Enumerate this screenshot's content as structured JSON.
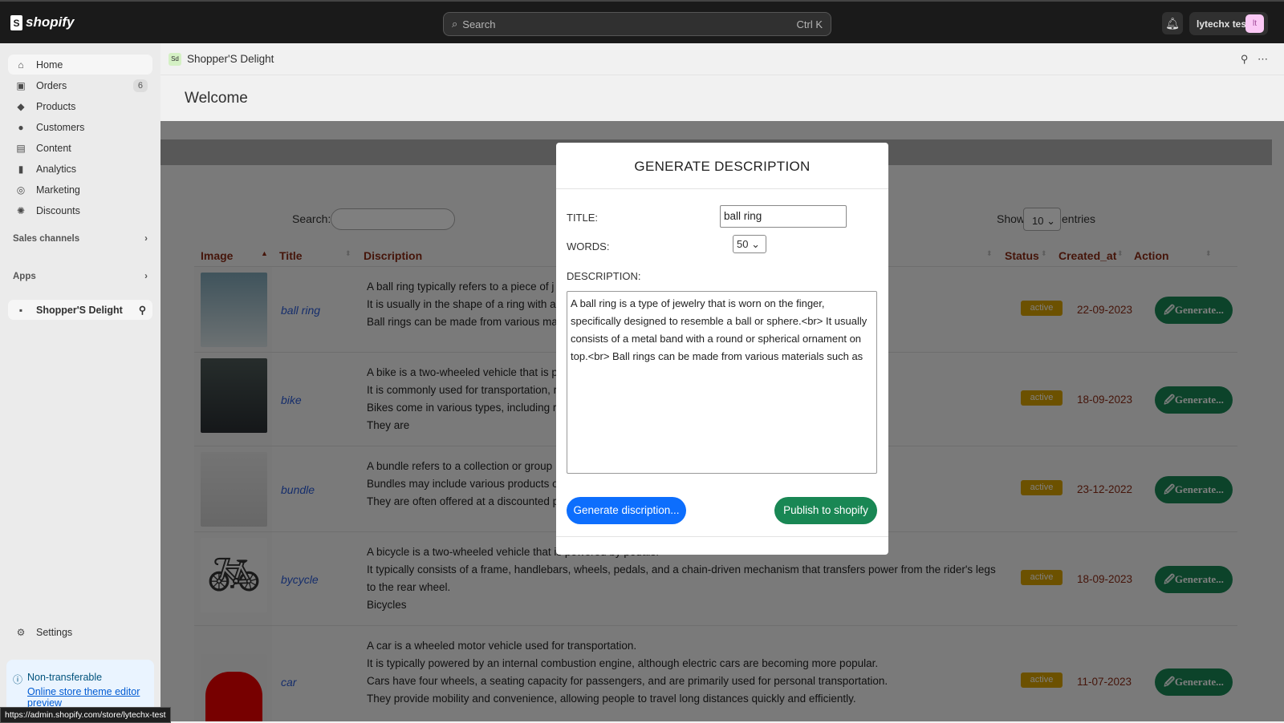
{
  "topbar": {
    "logo": "shopify",
    "search_placeholder": "Search",
    "shortcut": "Ctrl K",
    "user": "lytechx test",
    "avatar": "lt"
  },
  "sidebar": {
    "items": [
      {
        "label": "Home",
        "icon": "home-icon",
        "glyph": "⌂"
      },
      {
        "label": "Orders",
        "icon": "inbox-icon",
        "glyph": "▣",
        "badge": "6"
      },
      {
        "label": "Products",
        "icon": "tag-icon",
        "glyph": "◆"
      },
      {
        "label": "Customers",
        "icon": "person-icon",
        "glyph": "●"
      },
      {
        "label": "Content",
        "icon": "content-icon",
        "glyph": "▤"
      },
      {
        "label": "Analytics",
        "icon": "bar-chart-icon",
        "glyph": "▮"
      },
      {
        "label": "Marketing",
        "icon": "target-icon",
        "glyph": "◎"
      },
      {
        "label": "Discounts",
        "icon": "discount-icon",
        "glyph": "✺"
      }
    ],
    "sales_channels": "Sales channels",
    "apps": "Apps",
    "app_item": "Shopper'S Delight",
    "settings": "Settings",
    "notice": {
      "title": "Non-transferable",
      "link": "Online store theme editor preview"
    }
  },
  "status_url": "https://admin.shopify.com/store/lytechx-test",
  "app": {
    "name": "Shopper'S Delight",
    "welcome": "Welcome"
  },
  "table": {
    "search_label": "Search:",
    "show_label": "Show",
    "entries_value": "10",
    "entries_label": "entries",
    "headers": [
      "Image",
      "Title",
      "Discription",
      "Status",
      "Created_at",
      "Action"
    ],
    "rows": [
      {
        "title": "ball ring",
        "desc": [
          "A ball ring typically refers to a piece of j",
          "It is usually in the shape of a ring with a",
          "Ball rings can be made from various mat"
        ],
        "status": "active",
        "created": "22-09-2023",
        "action": "🖉Generate..."
      },
      {
        "title": "bike",
        "desc": [
          "A bike is a two-wheeled vehicle that is p",
          "It is commonly used for transportation, r",
          "Bikes come in various types, including ro",
          "They are"
        ],
        "status": "active",
        "created": "18-09-2023",
        "action": "🖉Generate..."
      },
      {
        "title": "bundle",
        "desc": [
          "A bundle refers to a collection or group",
          "Bundles may include various products o",
          "They are often offered at a discounted p"
        ],
        "status": "active",
        "created": "23-12-2022",
        "action": "🖉Generate..."
      },
      {
        "title": "bycycle",
        "desc": [
          "A bicycle is a two-wheeled vehicle that is powered by pedals.",
          "It typically consists of a frame, handlebars, wheels, pedals, and a chain-driven mechanism that transfers power from the rider's legs to the rear wheel.",
          "Bicycles"
        ],
        "status": "active",
        "created": "18-09-2023",
        "action": "🖉Generate..."
      },
      {
        "title": "car",
        "desc": [
          "A car is a wheeled motor vehicle used for transportation.",
          "It is typically powered by an internal combustion engine, although electric cars are becoming more popular.",
          "Cars have four wheels, a seating capacity for passengers, and are primarily used for personal transportation.",
          "They provide mobility and convenience, allowing people to travel long distances quickly and efficiently."
        ],
        "status": "active",
        "created": "11-07-2023",
        "action": "🖉Generate..."
      }
    ]
  },
  "modal": {
    "title": "GENERATE DESCRIPTION",
    "title_label": "TITLE:",
    "title_value": "ball ring",
    "words_label": "WORDS:",
    "words_value": "50",
    "desc_label": "DESCRIPTION:",
    "desc_value": "A ball ring is a type of jewelry that is worn on the finger, specifically designed to resemble a ball or sphere.<br> It usually consists of a metal band with a round or spherical ornament on top.<br> Ball rings can be made from various materials such as",
    "generate_btn": "Generate discription...",
    "publish_btn": "Publish to shopify"
  },
  "colors": {
    "header_text": "#8b2a15",
    "status_active": "#d9a300",
    "generate_green": "#198754",
    "primary_blue": "#0d6efd"
  }
}
